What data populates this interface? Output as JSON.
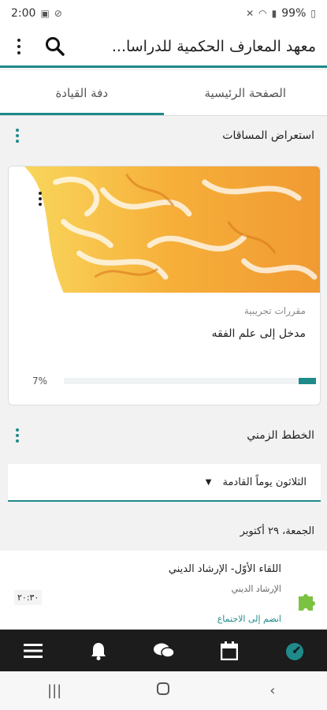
{
  "status": {
    "time": "2:00",
    "battery": "99%"
  },
  "appbar": {
    "title": "معهد المعارف الحكمية للدراسا..."
  },
  "tabs": [
    {
      "label": "الصفحة الرئيسية",
      "active": false
    },
    {
      "label": "دفة القيادة",
      "active": true
    }
  ],
  "courses_section": {
    "title": "استعراض المساقات"
  },
  "course": {
    "category": "مقررات تجريبية",
    "name": "مدخل إلى علم الفقه",
    "progress_label": "7%",
    "progress": 0.07
  },
  "timeline": {
    "title": "الخطط الزمني",
    "filter": "الثلاثون يوماً القادمة",
    "date": "الجمعة، ٢٩ أكتوبر",
    "event": {
      "title": "اللقاء الأوّل- الإرشاد الديني",
      "subtitle": "الإرشاد الديني",
      "action": "انضم إلى الاجتماع",
      "time": "٢٠:٣٠"
    }
  },
  "colors": {
    "accent": "#1f8a8a",
    "bottom_nav": "#1c1c1c",
    "banner_orange": "#f39a1d"
  },
  "bottom_nav": [
    "menu-icon",
    "bell-icon",
    "chat-icon",
    "calendar-icon",
    "dashboard-icon"
  ]
}
